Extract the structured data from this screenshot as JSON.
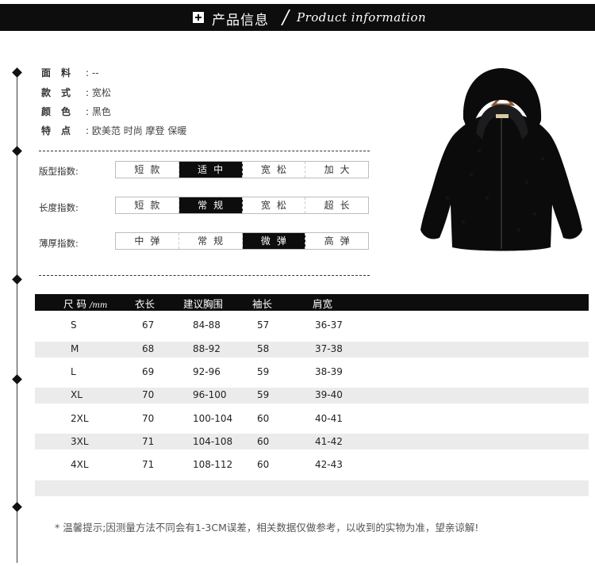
{
  "header": {
    "title_cn": "产品信息",
    "title_en": "Product information",
    "slash": "/"
  },
  "attributes": [
    {
      "label": "面料",
      "value": "--"
    },
    {
      "label": "款式",
      "value": "宽松"
    },
    {
      "label": "颜色",
      "value": "黑色"
    },
    {
      "label": "特点",
      "value": "欧美范 时尚 摩登 保暖"
    }
  ],
  "indexes": [
    {
      "label": "版型指数:",
      "options": [
        "短款",
        "适中",
        "宽松",
        "加大"
      ],
      "selected": "适中"
    },
    {
      "label": "长度指数:",
      "options": [
        "短款",
        "常规",
        "宽松",
        "超长"
      ],
      "selected": "常规"
    },
    {
      "label": "薄厚指数:",
      "options": [
        "中弹",
        "常规",
        "微弹",
        "高弹"
      ],
      "selected": "微弹"
    }
  ],
  "product_image": {
    "icon": "hooded-coat-image",
    "color": "#0b0b0c",
    "hanger_color": "#8a5a3a"
  },
  "size_table": {
    "headers": {
      "size": "尺 码",
      "unit": "/mm",
      "length": "衣长",
      "bust": "建议胸围",
      "sleeve": "袖长",
      "shoulder": "肩宽"
    },
    "rows": [
      {
        "size": "S",
        "length": "67",
        "bust": "84-88",
        "sleeve": "57",
        "shoulder": "36-37"
      },
      {
        "size": "M",
        "length": "68",
        "bust": "88-92",
        "sleeve": "58",
        "shoulder": "37-38"
      },
      {
        "size": "L",
        "length": "69",
        "bust": "92-96",
        "sleeve": "59",
        "shoulder": "38-39"
      },
      {
        "size": "XL",
        "length": "70",
        "bust": "96-100",
        "sleeve": "59",
        "shoulder": "39-40"
      },
      {
        "size": "2XL",
        "length": "70",
        "bust": "100-104",
        "sleeve": "60",
        "shoulder": "40-41"
      },
      {
        "size": "3XL",
        "length": "71",
        "bust": "104-108",
        "sleeve": "60",
        "shoulder": "41-42"
      },
      {
        "size": "4XL",
        "length": "71",
        "bust": "108-112",
        "sleeve": "60",
        "shoulder": "42-43"
      }
    ]
  },
  "footer": {
    "note": "* 温馨提示;因测量方法不同会有1-3CM误差，相关数据仅做参考，以收到的实物为准，望亲谅解!"
  },
  "colors": {
    "accent": "#0d0d0d",
    "row_band": "#ebebeb",
    "text": "#333333"
  }
}
